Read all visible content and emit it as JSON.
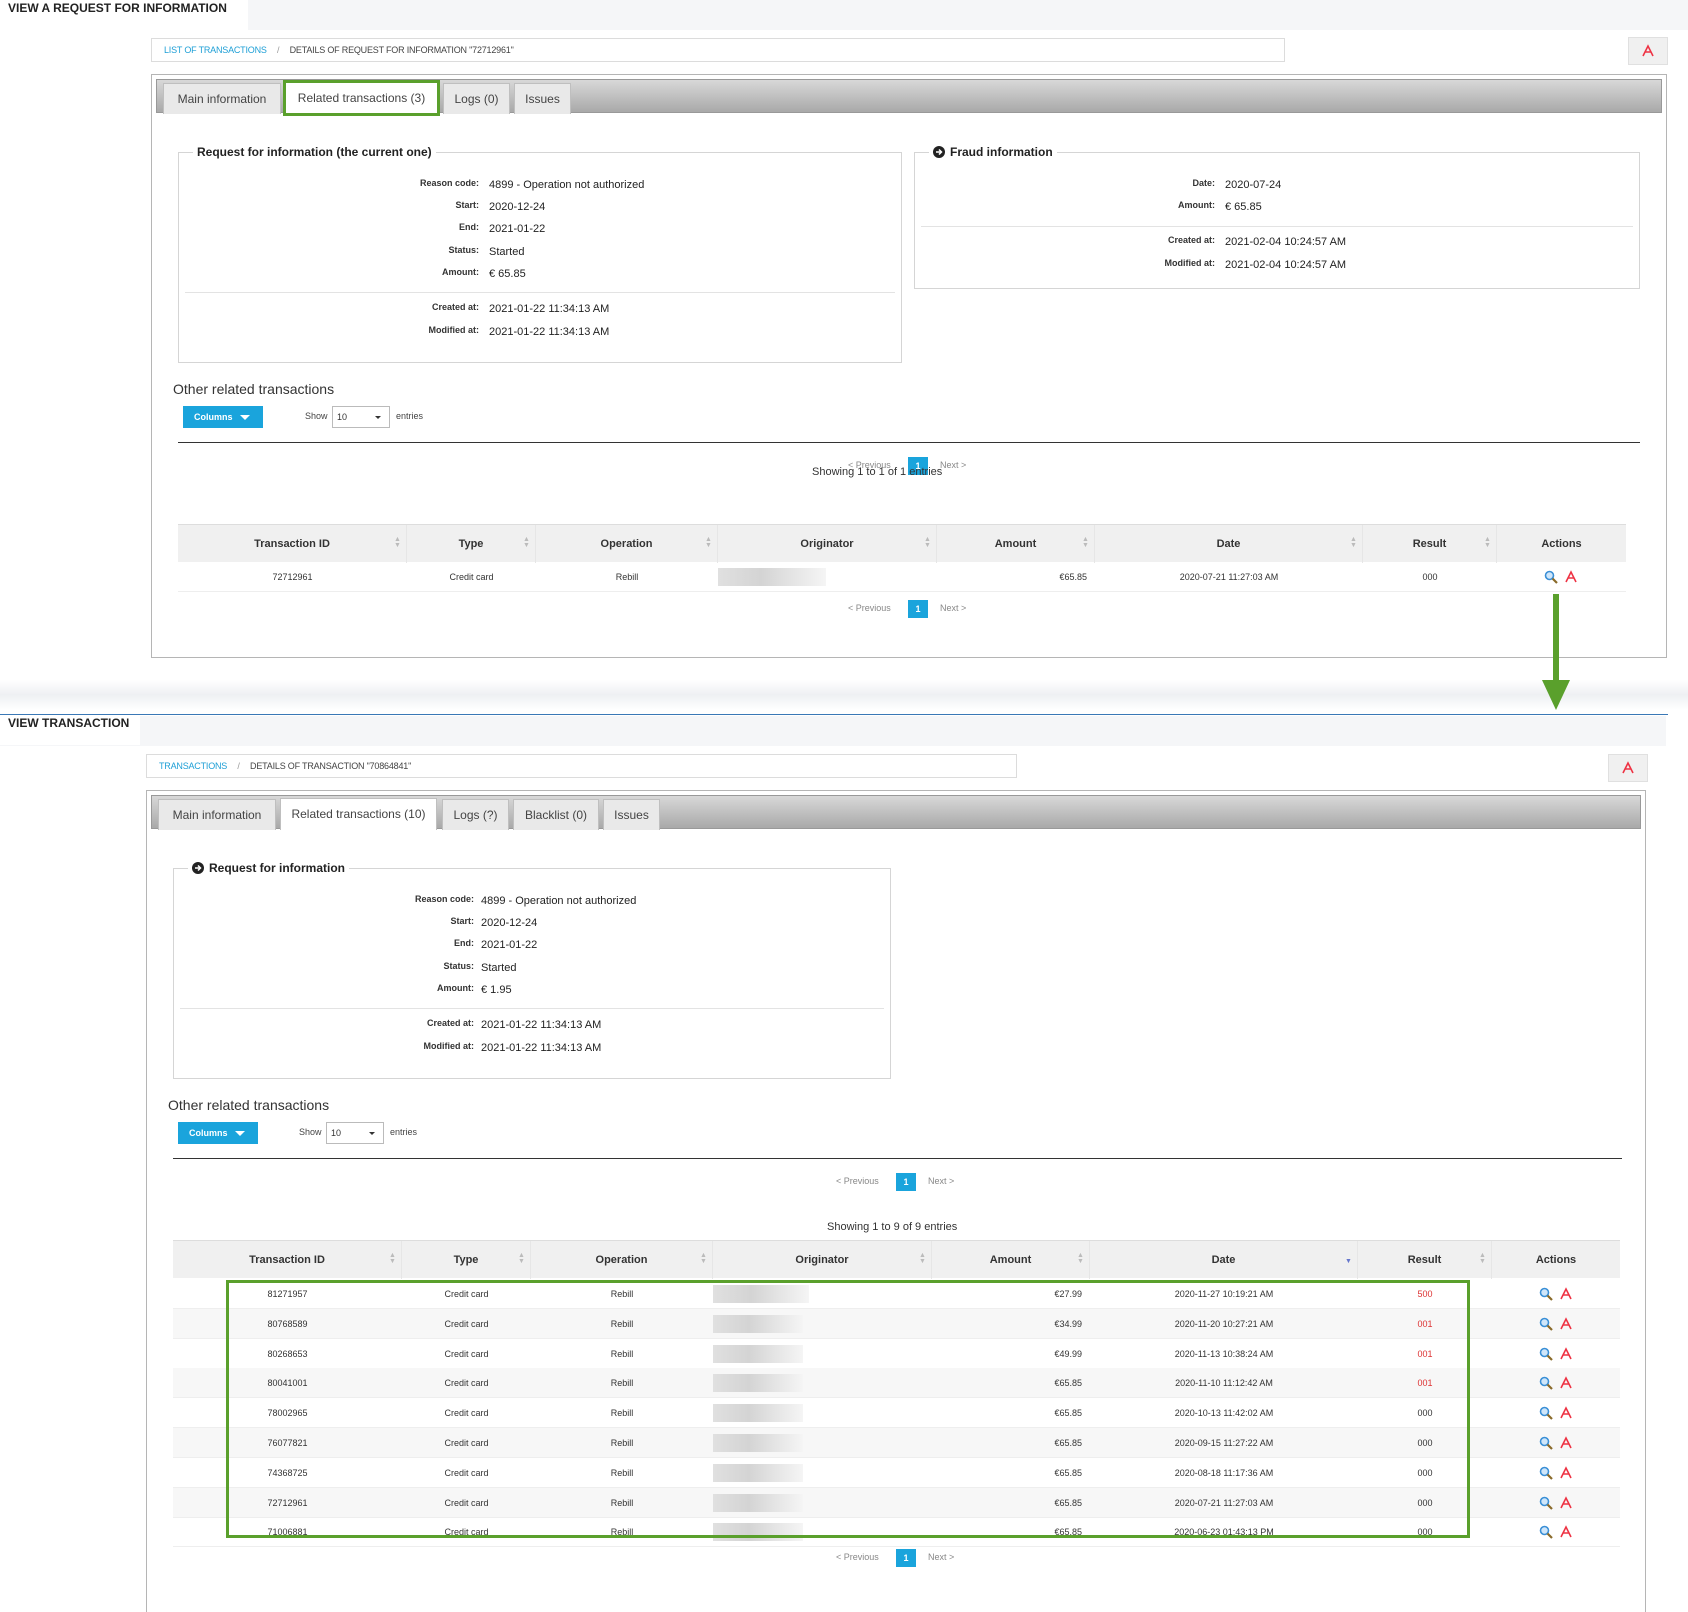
{
  "top": {
    "header_title": "View a request for information",
    "breadcrumb": {
      "link": "List of transactions",
      "current": "Details of request for information \"72712961\""
    },
    "tabs": [
      {
        "label": "Main information"
      },
      {
        "label": "Related transactions (3)"
      },
      {
        "label": "Logs (0)"
      },
      {
        "label": "Issues"
      }
    ],
    "rfi": {
      "legend": "Request for information (the current one)",
      "fields": [
        {
          "label": "Reason code:",
          "value": "4899 - Operation not authorized"
        },
        {
          "label": "Start:",
          "value": "2020-12-24"
        },
        {
          "label": "End:",
          "value": "2021-01-22"
        },
        {
          "label": "Status:",
          "value": "Started"
        },
        {
          "label": "Amount:",
          "value": "€ 65.85"
        }
      ],
      "meta": [
        {
          "label": "Created at:",
          "value": "2021-01-22 11:34:13 AM"
        },
        {
          "label": "Modified at:",
          "value": "2021-01-22 11:34:13 AM"
        }
      ]
    },
    "fraud": {
      "legend": "Fraud information",
      "fields": [
        {
          "label": "Date:",
          "value": "2020-07-24"
        },
        {
          "label": "Amount:",
          "value": "€ 65.85"
        }
      ],
      "meta": [
        {
          "label": "Created at:",
          "value": "2021-02-04 10:24:57 AM"
        },
        {
          "label": "Modified at:",
          "value": "2021-02-04 10:24:57 AM"
        }
      ]
    },
    "other_title": "Other related transactions",
    "columns_label": "Columns",
    "show_label": "Show",
    "show_value": "10",
    "entries_label": "entries",
    "pager": {
      "prev": "< Previous",
      "page": "1",
      "next": "Next >"
    },
    "showing": "Showing 1 to 1 of 1 entries",
    "table": {
      "headers": [
        "Transaction ID",
        "Type",
        "Operation",
        "Originator",
        "Amount",
        "Date",
        "Result",
        "Actions"
      ],
      "rows": [
        {
          "id": "72712961",
          "type": "Credit card",
          "operation": "Rebill",
          "amount": "€65.85",
          "date": "2020-07-21 11:27:03 AM",
          "result": "000"
        }
      ]
    }
  },
  "bottom": {
    "header_title": "View transaction",
    "breadcrumb": {
      "link": "Transactions",
      "current": "Details of transaction \"70864841\""
    },
    "tabs": [
      {
        "label": "Main information"
      },
      {
        "label": "Related transactions (10)"
      },
      {
        "label": "Logs (?)"
      },
      {
        "label": "Blacklist (0)"
      },
      {
        "label": "Issues"
      }
    ],
    "rfi": {
      "legend": "Request for information",
      "fields": [
        {
          "label": "Reason code:",
          "value": "4899 - Operation not authorized"
        },
        {
          "label": "Start:",
          "value": "2020-12-24"
        },
        {
          "label": "End:",
          "value": "2021-01-22"
        },
        {
          "label": "Status:",
          "value": "Started"
        },
        {
          "label": "Amount:",
          "value": "€ 1.95"
        }
      ],
      "meta": [
        {
          "label": "Created at:",
          "value": "2021-01-22 11:34:13 AM"
        },
        {
          "label": "Modified at:",
          "value": "2021-01-22 11:34:13 AM"
        }
      ]
    },
    "other_title": "Other related transactions",
    "columns_label": "Columns",
    "show_label": "Show",
    "show_value": "10",
    "entries_label": "entries",
    "pager": {
      "prev": "< Previous",
      "page": "1",
      "next": "Next >"
    },
    "showing": "Showing 1 to 9 of 9 entries",
    "table": {
      "headers": [
        "Transaction ID",
        "Type",
        "Operation",
        "Originator",
        "Amount",
        "Date",
        "Result",
        "Actions"
      ],
      "rows": [
        {
          "id": "81271957",
          "type": "Credit card",
          "operation": "Rebill",
          "amount": "€27.99",
          "date": "2020-11-27 10:19:21 AM",
          "result": "500",
          "failed": true
        },
        {
          "id": "80768589",
          "type": "Credit card",
          "operation": "Rebill",
          "amount": "€34.99",
          "date": "2020-11-20 10:27:21 AM",
          "result": "001",
          "failed": true
        },
        {
          "id": "80268653",
          "type": "Credit card",
          "operation": "Rebill",
          "amount": "€49.99",
          "date": "2020-11-13 10:38:24 AM",
          "result": "001",
          "failed": true
        },
        {
          "id": "80041001",
          "type": "Credit card",
          "operation": "Rebill",
          "amount": "€65.85",
          "date": "2020-11-10 11:12:42 AM",
          "result": "001",
          "failed": true
        },
        {
          "id": "78002965",
          "type": "Credit card",
          "operation": "Rebill",
          "amount": "€65.85",
          "date": "2020-10-13 11:42:02 AM",
          "result": "000",
          "failed": false
        },
        {
          "id": "76077821",
          "type": "Credit card",
          "operation": "Rebill",
          "amount": "€65.85",
          "date": "2020-09-15 11:27:22 AM",
          "result": "000",
          "failed": false
        },
        {
          "id": "74368725",
          "type": "Credit card",
          "operation": "Rebill",
          "amount": "€65.85",
          "date": "2020-08-18 11:17:36 AM",
          "result": "000",
          "failed": false
        },
        {
          "id": "72712961",
          "type": "Credit card",
          "operation": "Rebill",
          "amount": "€65.85",
          "date": "2020-07-21 11:27:03 AM",
          "result": "000",
          "failed": false
        },
        {
          "id": "71006881",
          "type": "Credit card",
          "operation": "Rebill",
          "amount": "€65.85",
          "date": "2020-06-23 01:43:13 PM",
          "result": "000",
          "failed": false
        }
      ]
    }
  },
  "icons": {
    "pdf": "pdf-export-icon",
    "view": "magnifier-icon",
    "arrow": "arrow-circle-right-icon"
  },
  "colors": {
    "accent": "#1aa4dc",
    "highlight": "#5aa02c",
    "error": "#dd3333"
  }
}
